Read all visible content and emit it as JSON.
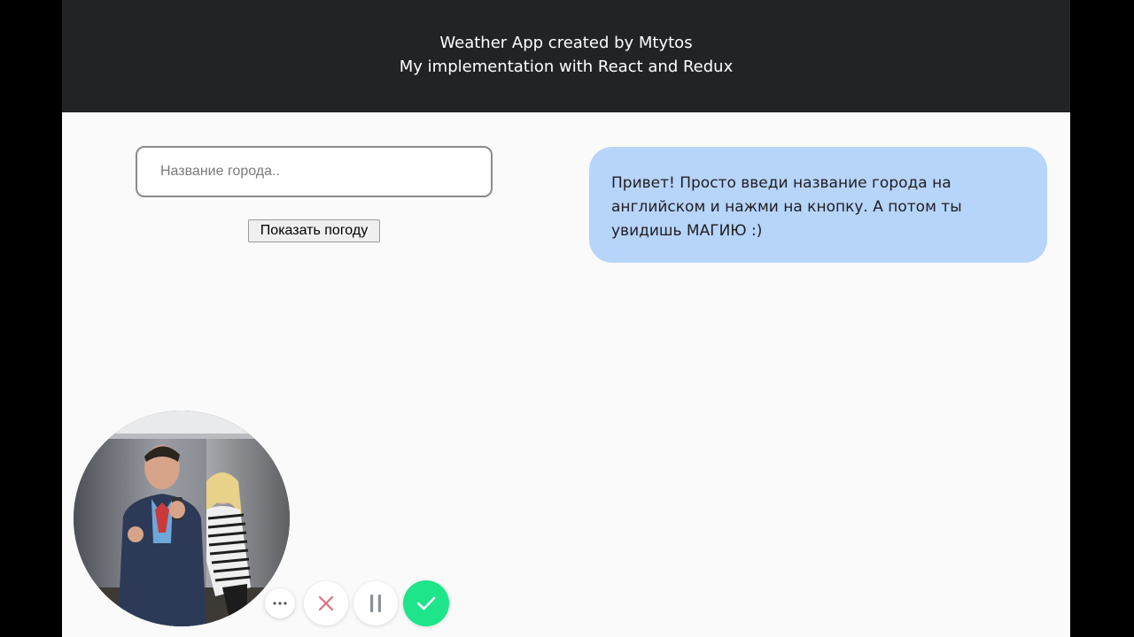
{
  "header": {
    "title": "Weather App created by Mtytos",
    "subtitle": "My implementation with React and Redux"
  },
  "search": {
    "placeholder": "Название города..",
    "value": ""
  },
  "show_button": {
    "label": "Показать погоду"
  },
  "message": {
    "text": "Привет! Просто введи название города на английском и нажми на кнопку. А потом ты увидишь МАГИЮ :)"
  },
  "colors": {
    "header_bg": "#222325",
    "page_bg": "#fafafa",
    "bubble_bg": "#b7d4fb",
    "confirm_green": "#1ee58a",
    "close_red": "#e0707e"
  },
  "recorder_controls": [
    {
      "icon": "more-icon"
    },
    {
      "icon": "close-icon"
    },
    {
      "icon": "pause-icon"
    },
    {
      "icon": "check-icon"
    }
  ]
}
